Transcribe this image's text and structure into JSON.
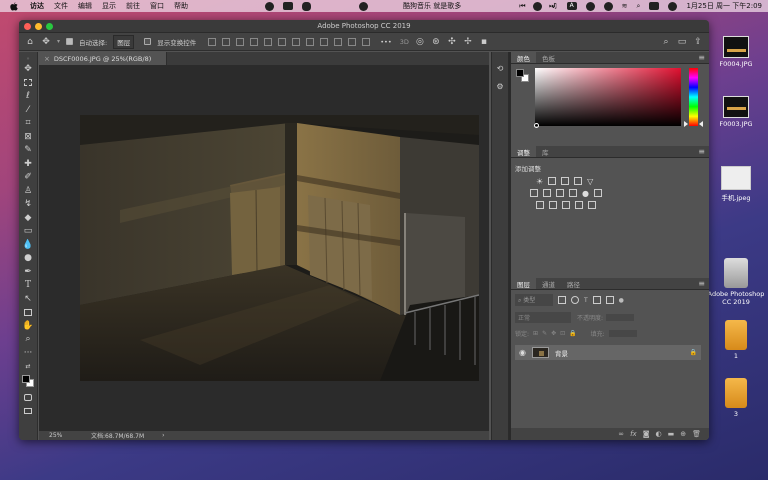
{
  "menubar": {
    "app_menus": [
      "访达",
      "文件",
      "编辑",
      "显示",
      "前往",
      "窗口",
      "帮助"
    ],
    "now_playing": "酷狗音乐 就是歌多",
    "clock": "1月25日 周一 下午2:09",
    "input_method": "A"
  },
  "window": {
    "title": "Adobe Photoshop CC 2019",
    "traffic_colors": [
      "#ff5f57",
      "#febc2e",
      "#28c840"
    ]
  },
  "options_bar": {
    "auto_select_label": "自动选择:",
    "auto_select_value": "图层",
    "show_transform_label": "显示变换控件"
  },
  "document": {
    "tab_label": "DSCF0006.JPG @ 25%(RGB/8)",
    "zoom": "25%",
    "doc_size": "文档:68.7M/68.7M"
  },
  "color_panel": {
    "tabs": [
      "颜色",
      "色板"
    ]
  },
  "adjustments_panel": {
    "tabs": [
      "调整",
      "库"
    ],
    "add_label": "添加调整"
  },
  "layers_panel": {
    "tabs": [
      "图层",
      "通道",
      "路径"
    ],
    "kind_label": "类型",
    "blend_mode": "正常",
    "opacity_label": "不透明度:",
    "lock_label": "锁定:",
    "fill_label": "填充:",
    "layers": [
      {
        "name": "背景"
      }
    ]
  },
  "desktop": {
    "icons": [
      {
        "label": "F0004.JPG"
      },
      {
        "label": "F0003.JPG"
      },
      {
        "label": "手机.jpeg"
      },
      {
        "label": "Adobe Photoshop CC 2019"
      },
      {
        "label": "1"
      },
      {
        "label": "3"
      }
    ]
  },
  "accent": "#31a8ff",
  "foreground_color": "#000000",
  "background_color": "#ffffff"
}
